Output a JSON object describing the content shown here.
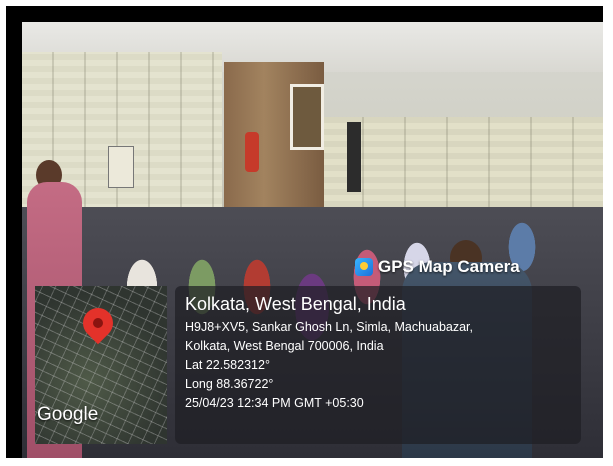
{
  "overlay": {
    "brand": "GPS Map Camera",
    "map_logo": "Google",
    "location_title": "Kolkata, West Bengal, India",
    "address_line1": "H9J8+XV5, Sankar Ghosh Ln, Simla, Machuabazar,",
    "address_line2": "Kolkata, West Bengal 700006, India",
    "latitude": "Lat 22.582312°",
    "longitude": "Long 88.36722°",
    "timestamp": "25/04/23 12:34 PM GMT +05:30"
  },
  "icons": {
    "brand": "camera-map-icon",
    "pin": "map-pin-icon"
  },
  "colors": {
    "pin": "#e3322a",
    "overlay_bg": "#1e1e24",
    "text": "#ffffff"
  }
}
